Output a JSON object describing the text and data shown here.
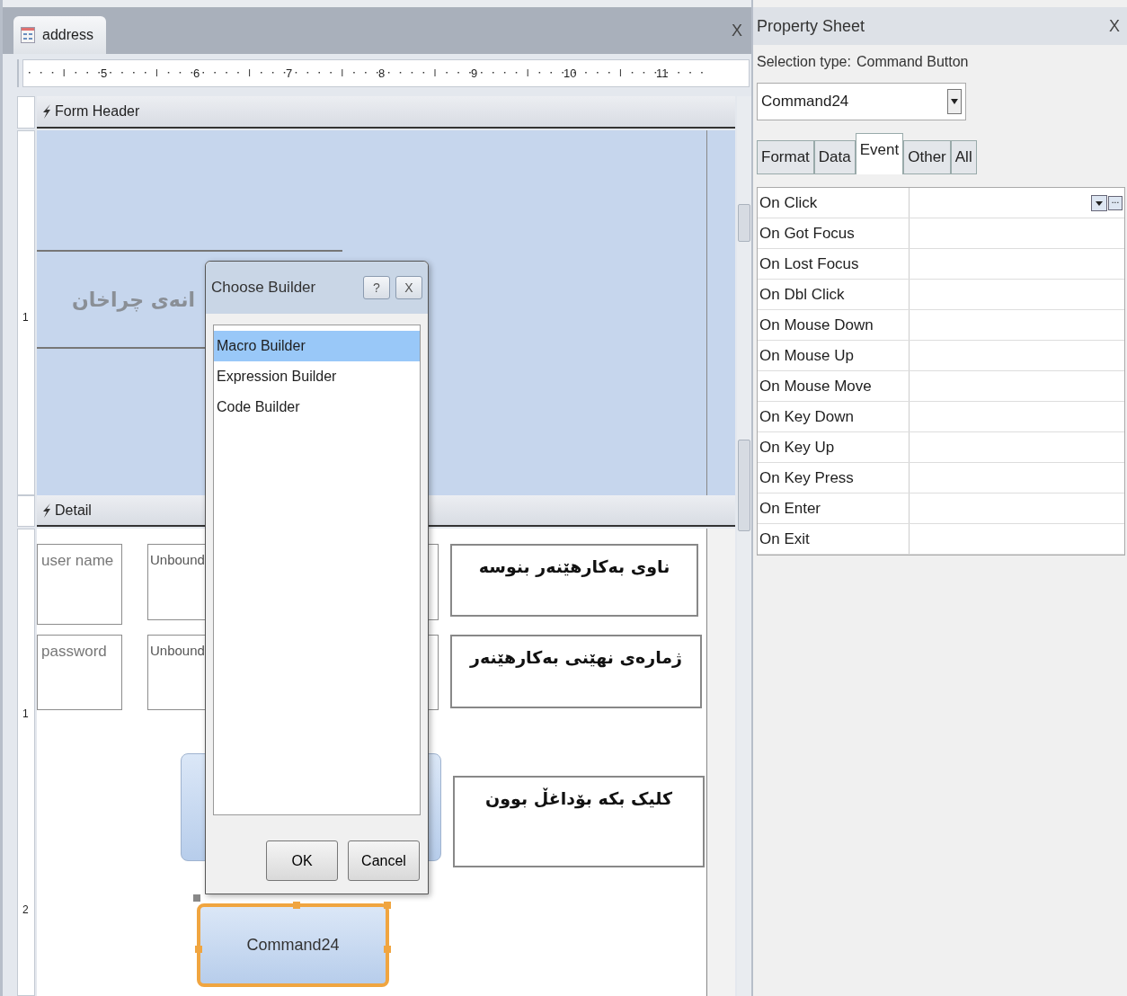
{
  "document_tab": {
    "title": "address",
    "close": "X"
  },
  "ruler": {
    "labels": [
      "5",
      "6",
      "7",
      "8",
      "9",
      "10",
      "11"
    ]
  },
  "form_header": {
    "title": "Form Header",
    "ruler_labels": [
      "1"
    ],
    "label": "انەی چراخان"
  },
  "detail": {
    "title": "Detail",
    "ruler_labels": [
      "1",
      "2"
    ],
    "controls": [
      {
        "kind": "label",
        "text": "user name"
      },
      {
        "kind": "textbox",
        "text": "Unbound"
      },
      {
        "kind": "label",
        "text": "password"
      },
      {
        "kind": "textbox",
        "text": "Unbound"
      },
      {
        "kind": "caption",
        "text": "ناوی بەکارهێنەر بنوسە"
      },
      {
        "kind": "caption",
        "text": "ژمارەی نهێنی بەکارهێنەر"
      },
      {
        "kind": "caption",
        "text": "کلیک بکە بۆداغڵ بوون"
      },
      {
        "kind": "button",
        "selected": false
      },
      {
        "kind": "button",
        "text": "Command24",
        "selected": true
      }
    ]
  },
  "dialog": {
    "title": "Choose Builder",
    "help": "?",
    "close": "X",
    "items": [
      {
        "label": "Macro Builder",
        "selected": true
      },
      {
        "label": "Expression Builder",
        "selected": false
      },
      {
        "label": "Code Builder",
        "selected": false
      }
    ],
    "buttons": [
      "OK",
      "Cancel"
    ]
  },
  "property_sheet": {
    "title": "Property Sheet",
    "close": "X",
    "selection_type_label": "Selection type:",
    "selection_type": "Command Button",
    "object": "Command24",
    "tabs": [
      {
        "label": "Format",
        "selected": false
      },
      {
        "label": "Data",
        "selected": false
      },
      {
        "label": "Event",
        "selected": true
      },
      {
        "label": "Other",
        "selected": false
      },
      {
        "label": "All",
        "selected": false
      }
    ],
    "builder_button": "...",
    "properties": [
      {
        "name": "On Click",
        "selected": true
      },
      {
        "name": "On Got Focus",
        "selected": false
      },
      {
        "name": "On Lost Focus",
        "selected": false
      },
      {
        "name": "On Dbl Click",
        "selected": false
      },
      {
        "name": "On Mouse Down",
        "selected": false
      },
      {
        "name": "On Mouse Up",
        "selected": false
      },
      {
        "name": "On Mouse Move",
        "selected": false
      },
      {
        "name": "On Key Down",
        "selected": false
      },
      {
        "name": "On Key Up",
        "selected": false
      },
      {
        "name": "On Key Press",
        "selected": false
      },
      {
        "name": "On Enter",
        "selected": false
      },
      {
        "name": "On Exit",
        "selected": false
      }
    ]
  }
}
